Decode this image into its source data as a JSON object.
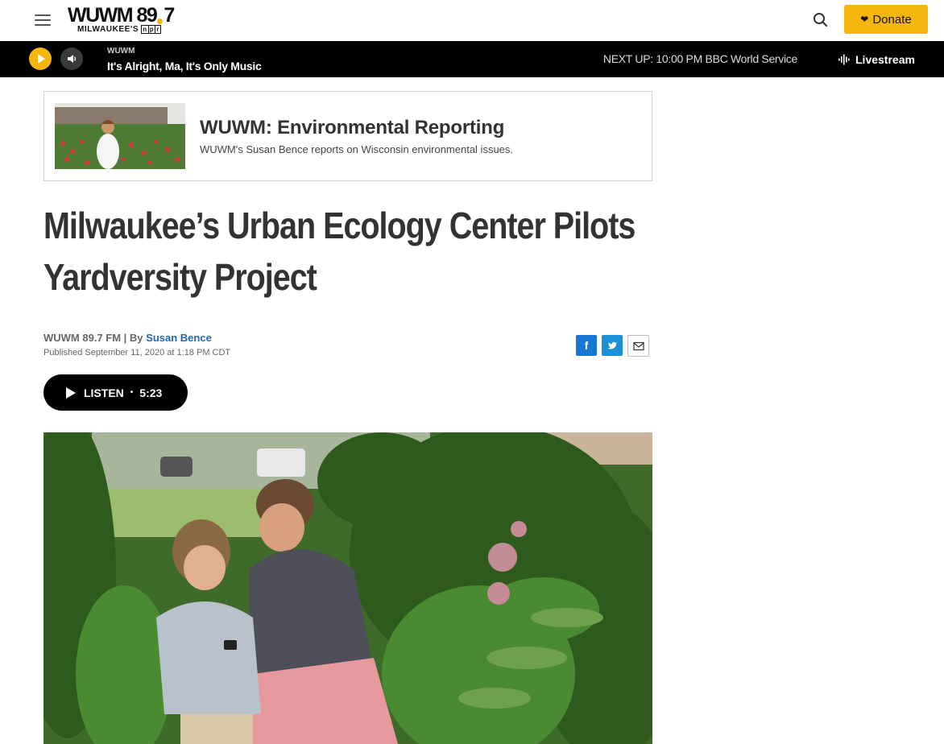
{
  "header": {
    "logo_main": "WUWM 89",
    "logo_freq_tail": "7",
    "logo_sub": "MILWAUKEE'S",
    "npr_letters": [
      "n",
      "p",
      "r"
    ],
    "donate_label": "Donate"
  },
  "player": {
    "station": "WUWM",
    "show": "It's Alright, Ma, It's Only Music",
    "next_up": "NEXT UP: 10:00 PM BBC World Service",
    "livestream_label": "Livestream"
  },
  "program": {
    "title": "WUWM: Environmental Reporting",
    "description": "WUWM's Susan Bence reports on Wisconsin environmental issues."
  },
  "article": {
    "headline": "Milwaukee’s Urban Ecology Center Pilots Yardversity Project",
    "source": "WUWM 89.7 FM | By ",
    "author": "Susan Bence",
    "published": "Published September 11, 2020 at 1:18 PM CDT",
    "listen_label": "LISTEN",
    "listen_separator": "•",
    "listen_duration": "5:23"
  },
  "colors": {
    "brand_yellow": "#f5b60d",
    "player_bg": "#000000",
    "link_blue": "#2266aa",
    "facebook": "#1877d2",
    "twitter": "#1d8fd6"
  },
  "icons": [
    "menu-icon",
    "search-icon",
    "heart-icon",
    "play-icon",
    "volume-icon",
    "waveform-icon",
    "facebook-icon",
    "twitter-icon",
    "email-icon"
  ]
}
